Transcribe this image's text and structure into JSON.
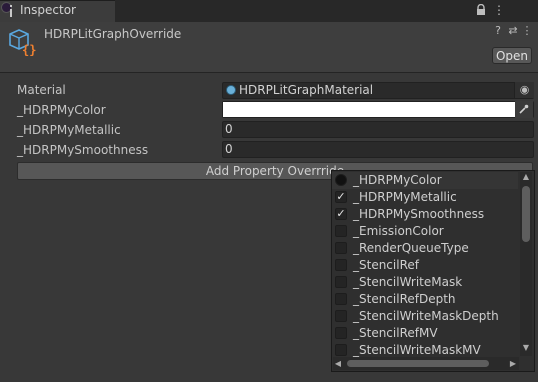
{
  "tab": {
    "label": "Inspector"
  },
  "header": {
    "title": "HDRPLitGraphOverride",
    "open_label": "Open",
    "help_icon": "?",
    "settings_icon": "⇄",
    "menu_icon": "⋮"
  },
  "tabbar_icons": {
    "lock": "🔒",
    "menu": "⋮"
  },
  "properties": [
    {
      "label": "Material",
      "value": "HDRPLitGraphMaterial"
    },
    {
      "label": "_HDRPMyColor",
      "value": "",
      "color": "#ffffff"
    },
    {
      "label": "_HDRPMyMetallic",
      "value": "0"
    },
    {
      "label": "_HDRPMySmoothness",
      "value": "0"
    }
  ],
  "add_override_label": "Add Property Overrride",
  "dropdown": {
    "items": [
      {
        "label": "_HDRPMyColor",
        "checked": false
      },
      {
        "label": "_HDRPMyMetallic",
        "checked": true
      },
      {
        "label": "_HDRPMySmoothness",
        "checked": true
      },
      {
        "label": "_EmissionColor",
        "checked": false
      },
      {
        "label": "_RenderQueueType",
        "checked": false
      },
      {
        "label": "_StencilRef",
        "checked": false
      },
      {
        "label": "_StencilWriteMask",
        "checked": false
      },
      {
        "label": "_StencilRefDepth",
        "checked": false
      },
      {
        "label": "_StencilWriteMaskDepth",
        "checked": false
      },
      {
        "label": "_StencilRefMV",
        "checked": false
      },
      {
        "label": "_StencilWriteMaskMV",
        "checked": false
      }
    ]
  },
  "colors": {
    "background": "#383838",
    "field": "#2a2a2a",
    "accent_material": "#6ab0d8",
    "shader_icon": "#5aa8e0",
    "shader_braces": "#f08030"
  }
}
